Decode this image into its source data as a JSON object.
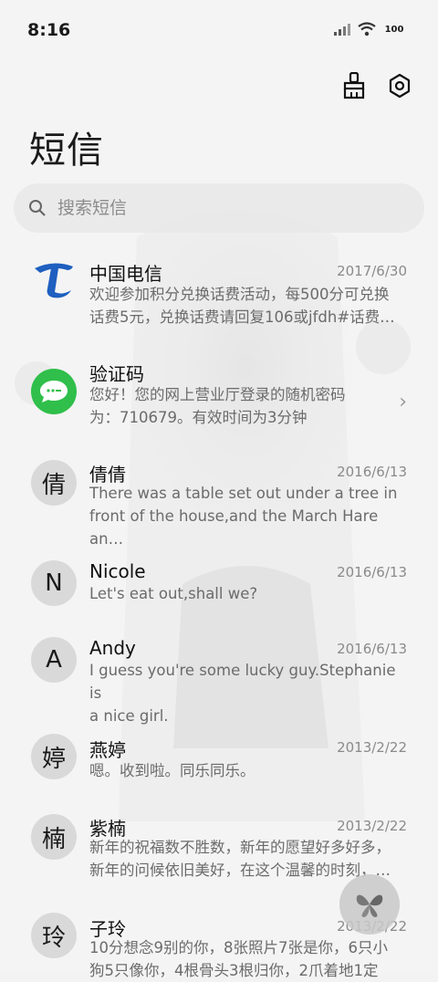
{
  "status_bar": {
    "time": "8:16",
    "battery": "100"
  },
  "header": {
    "title": "短信"
  },
  "search": {
    "placeholder": "搜索短信"
  },
  "conversations": [
    {
      "name": "中国电信",
      "date": "2017/6/30",
      "preview_1": "欢迎参加积分兑换话费活动，每500分可兑换",
      "preview_2": "话费5元，兑换话费请回复106或jfdh#话费…",
      "avatar": "china-telecom-logo"
    },
    {
      "name": "验证码",
      "date": "",
      "preview_1": "您好！您的网上营业厅登录的随机密码",
      "preview_2": "为：710679。有效时间为3分钟",
      "avatar": "message-bubble-icon"
    },
    {
      "name": "倩倩",
      "date": "2016/6/13",
      "preview_1": "There was a table set out under a tree in",
      "preview_2": "front of the house,and the March Hare an…",
      "avatar_text": "倩"
    },
    {
      "name": "Nicole",
      "date": "2016/6/13",
      "preview_1": "Let's eat out,shall we?",
      "preview_2": "",
      "avatar_text": "N"
    },
    {
      "name": "Andy",
      "date": "2016/6/13",
      "preview_1": "I guess you're some lucky guy.Stephanie is",
      "preview_2": "a nice girl.",
      "avatar_text": "A"
    },
    {
      "name": "燕婷",
      "date": "2013/2/22",
      "preview_1": "嗯。收到啦。同乐同乐。",
      "preview_2": "",
      "avatar_text": "婷"
    },
    {
      "name": "紫楠",
      "date": "2013/2/22",
      "preview_1": "新年的祝福数不胜数，新年的愿望好多好多，",
      "preview_2": "新年的问候依旧美好，在这个温馨的时刻，…",
      "avatar_text": "楠"
    },
    {
      "name": "子玲",
      "date": "2013/2/22",
      "preview_1": "10分想念9别的你，8张照片7张是你，6只小",
      "preview_2": "狗5只像你，4根骨头3根归你，2爪着地1定",
      "avatar_text": "玲"
    }
  ],
  "colors": {
    "telecom_blue": "#1e5fbf",
    "message_green": "#2fbf4a"
  }
}
